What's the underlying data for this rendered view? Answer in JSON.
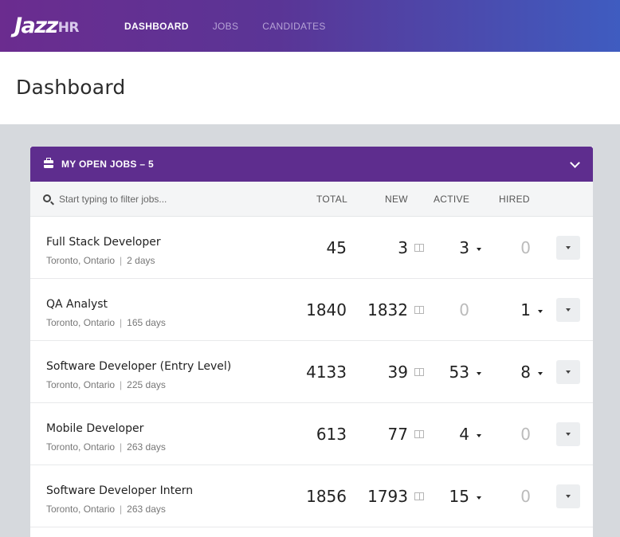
{
  "app": {
    "logo_main": "Jazz",
    "logo_suffix": "HR",
    "nav": {
      "dashboard": "DASHBOARD",
      "jobs": "JOBS",
      "candidates": "CANDIDATES"
    },
    "page_title": "Dashboard"
  },
  "panel": {
    "title": "MY OPEN JOBS  –  5",
    "icon": "briefcase-icon",
    "filter_placeholder": "Start typing to filter jobs...",
    "columns": {
      "total": "TOTAL",
      "new": "NEW",
      "active": "ACTIVE",
      "hired": "HIRED"
    }
  },
  "jobs": [
    {
      "title": "Full Stack Developer",
      "location": "Toronto, Ontario",
      "age": "2 days",
      "total": "45",
      "new": "3",
      "active": "3",
      "hired": "0"
    },
    {
      "title": "QA Analyst",
      "location": "Toronto, Ontario",
      "age": "165 days",
      "total": "1840",
      "new": "1832",
      "active": "0",
      "hired": "1"
    },
    {
      "title": "Software Developer (Entry Level)",
      "location": "Toronto, Ontario",
      "age": "225 days",
      "total": "4133",
      "new": "39",
      "active": "53",
      "hired": "8"
    },
    {
      "title": "Mobile Developer",
      "location": "Toronto, Ontario",
      "age": "263 days",
      "total": "613",
      "new": "77",
      "active": "4",
      "hired": "0"
    },
    {
      "title": "Software Developer Intern",
      "location": "Toronto, Ontario",
      "age": "263 days",
      "total": "1856",
      "new": "1793",
      "active": "15",
      "hired": "0"
    }
  ],
  "colors": {
    "topbar_start": "#6b2c8f",
    "topbar_end": "#3f5cc0",
    "panel_header": "#5e2d8e",
    "background": "#d6d9dd"
  }
}
